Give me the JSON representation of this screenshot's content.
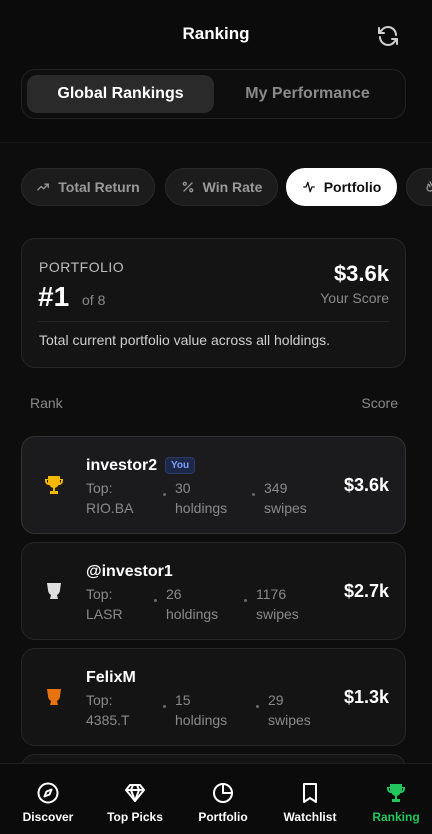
{
  "header": {
    "title": "Ranking"
  },
  "tabs": {
    "active": "Global Rankings",
    "inactive": "My Performance"
  },
  "filters": [
    {
      "label": "Total Return",
      "icon": "trend-up-icon"
    },
    {
      "label": "Win Rate",
      "icon": "percent-icon"
    },
    {
      "label": "Portfolio",
      "icon": "pulse-icon",
      "active": true
    }
  ],
  "summary": {
    "label": "PORTFOLIO",
    "rank": "#1",
    "of": "of 8",
    "score": "$3.6k",
    "score_label": "Your Score",
    "description": "Total current portfolio value across all holdings."
  },
  "columns": {
    "rank": "Rank",
    "score": "Score"
  },
  "rankings": [
    {
      "name": "investor2",
      "badge": "You",
      "top_label": "Top:",
      "top": "RIO.BA",
      "holdings_count": "30",
      "holdings_label": "holdings",
      "swipes_count": "349",
      "swipes_label": "swipes",
      "score": "$3.6k",
      "medal": "gold",
      "medal_color": "#f5b800"
    },
    {
      "name": "@investor1",
      "top_label": "Top:",
      "top": "LASR",
      "holdings_count": "26",
      "holdings_label": "holdings",
      "swipes_count": "1176",
      "swipes_label": "swipes",
      "score": "$2.7k",
      "medal": "silver",
      "medal_color": "#e0e0e0"
    },
    {
      "name": "FelixM",
      "top_label": "Top:",
      "top": "4385.T",
      "holdings_count": "15",
      "holdings_label": "holdings",
      "swipes_count": "29",
      "swipes_label": "swipes",
      "score": "$1.3k",
      "medal": "bronze",
      "medal_color": "#e8730c"
    }
  ],
  "nav": [
    {
      "label": "Discover",
      "icon": "compass-icon"
    },
    {
      "label": "Top Picks",
      "icon": "diamond-icon"
    },
    {
      "label": "Portfolio",
      "icon": "pie-chart-icon"
    },
    {
      "label": "Watchlist",
      "icon": "bookmark-icon"
    },
    {
      "label": "Ranking",
      "icon": "trophy-icon",
      "active": true
    }
  ],
  "colors": {
    "accent": "#22c55e",
    "background": "#0b0b0b",
    "card": "#141414"
  }
}
